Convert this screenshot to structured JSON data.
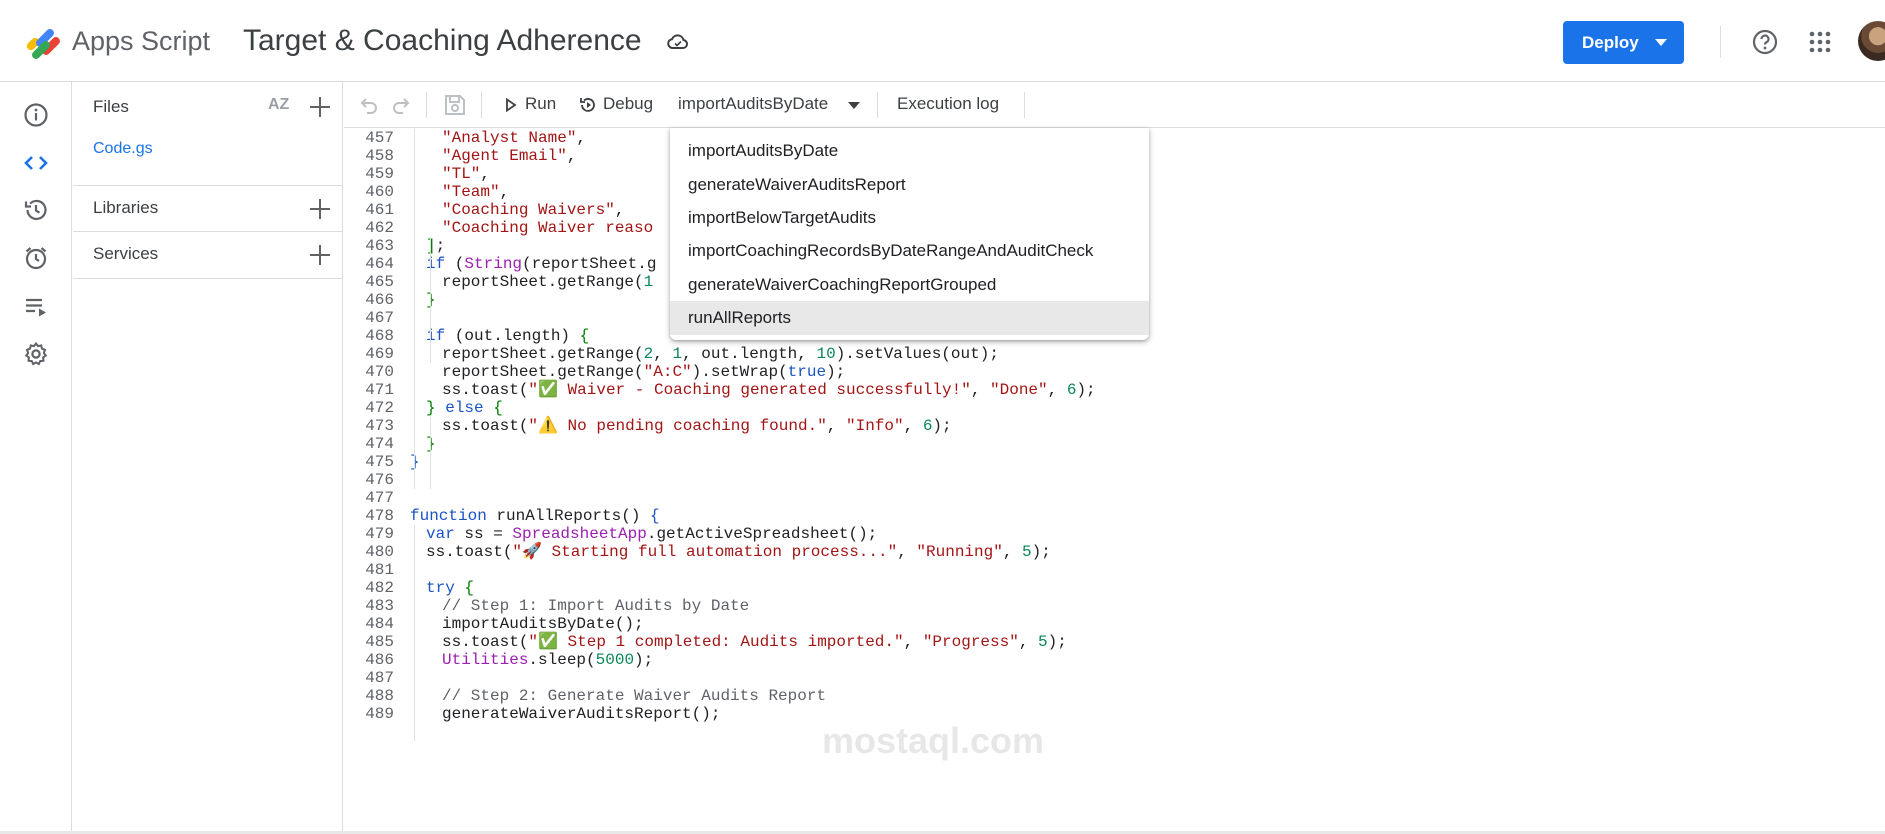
{
  "header": {
    "app_name": "Apps Script",
    "project_title": "Target & Coaching Adherence",
    "deploy_label": "Deploy",
    "icons": [
      "apps-script-logo",
      "cloud-sync-icon",
      "help-icon",
      "apps-grid-icon",
      "account-avatar"
    ]
  },
  "leftnav": {
    "icons": [
      "info-icon",
      "code-icon",
      "history-icon",
      "triggers-icon",
      "executions-icon",
      "settings-icon"
    ]
  },
  "files_panel": {
    "files_label": "Files",
    "sort_label": "AZ",
    "file_name": "Code.gs",
    "libraries_label": "Libraries",
    "services_label": "Services"
  },
  "toolbar": {
    "run_label": "Run",
    "debug_label": "Debug",
    "function_select": "importAuditsByDate",
    "execution_log_label": "Execution log"
  },
  "dropdown": {
    "options": [
      "importAuditsByDate",
      "generateWaiverAuditsReport",
      "importBelowTargetAudits",
      "importCoachingRecordsByDateRangeAndAuditCheck",
      "generateWaiverCoachingReportGrouped",
      "runAllReports"
    ],
    "selected_index": 5
  },
  "editor": {
    "lines": [
      {
        "n": "457",
        "ind": 2,
        "t": [
          [
            "s",
            "\"Analyst Name\""
          ],
          [
            "t",
            ","
          ]
        ]
      },
      {
        "n": "458",
        "ind": 2,
        "t": [
          [
            "s",
            "\"Agent Email\""
          ],
          [
            "t",
            ","
          ]
        ]
      },
      {
        "n": "459",
        "ind": 2,
        "t": [
          [
            "s",
            "\"TL\""
          ],
          [
            "t",
            ","
          ]
        ]
      },
      {
        "n": "460",
        "ind": 2,
        "t": [
          [
            "s",
            "\"Team\""
          ],
          [
            "t",
            ","
          ]
        ]
      },
      {
        "n": "461",
        "ind": 2,
        "t": [
          [
            "s",
            "\"Coaching Waivers\""
          ],
          [
            "t",
            ","
          ]
        ]
      },
      {
        "n": "462",
        "ind": 2,
        "t": [
          [
            "s",
            "\"Coaching Waiver reaso"
          ]
        ]
      },
      {
        "n": "463",
        "ind": 1,
        "t": [
          [
            "p",
            "]"
          ],
          [
            "t",
            ";"
          ]
        ]
      },
      {
        "n": "464",
        "ind": 1,
        "t": [
          [
            "k",
            "if"
          ],
          [
            "t",
            " ("
          ],
          [
            "cl",
            "String"
          ],
          [
            "t",
            "(reportSheet.g"
          ]
        ]
      },
      {
        "n": "465",
        "ind": 2,
        "t": [
          [
            "t",
            "reportSheet.getRange("
          ],
          [
            "n",
            "1"
          ]
        ]
      },
      {
        "n": "466",
        "ind": 1,
        "t": [
          [
            "p",
            "}"
          ]
        ]
      },
      {
        "n": "467",
        "ind": 0,
        "t": []
      },
      {
        "n": "468",
        "ind": 1,
        "t": [
          [
            "k",
            "if"
          ],
          [
            "t",
            " (out.length) "
          ],
          [
            "p",
            "{"
          ]
        ]
      },
      {
        "n": "469",
        "ind": 2,
        "t": [
          [
            "t",
            "reportSheet.getRange("
          ],
          [
            "n",
            "2"
          ],
          [
            "t",
            ", "
          ],
          [
            "n",
            "1"
          ],
          [
            "t",
            ", out.length, "
          ],
          [
            "n",
            "10"
          ],
          [
            "t",
            ").setValues(out);"
          ]
        ]
      },
      {
        "n": "470",
        "ind": 2,
        "t": [
          [
            "t",
            "reportSheet.getRange("
          ],
          [
            "s",
            "\"A:C\""
          ],
          [
            "t",
            ").setWrap("
          ],
          [
            "k",
            "true"
          ],
          [
            "t",
            ");"
          ]
        ]
      },
      {
        "n": "471",
        "ind": 2,
        "t": [
          [
            "t",
            "ss.toast("
          ],
          [
            "s",
            "\"✅ Waiver - Coaching generated successfully!\""
          ],
          [
            "t",
            ", "
          ],
          [
            "s",
            "\"Done\""
          ],
          [
            "t",
            ", "
          ],
          [
            "n",
            "6"
          ],
          [
            "t",
            ");"
          ]
        ]
      },
      {
        "n": "472",
        "ind": 1,
        "t": [
          [
            "p",
            "}"
          ],
          [
            "t",
            " "
          ],
          [
            "k",
            "else"
          ],
          [
            "t",
            " "
          ],
          [
            "p",
            "{"
          ]
        ]
      },
      {
        "n": "473",
        "ind": 2,
        "t": [
          [
            "t",
            "ss.toast("
          ],
          [
            "s",
            "\"⚠️ No pending coaching found.\""
          ],
          [
            "t",
            ", "
          ],
          [
            "s",
            "\"Info\""
          ],
          [
            "t",
            ", "
          ],
          [
            "n",
            "6"
          ],
          [
            "t",
            ");"
          ]
        ]
      },
      {
        "n": "474",
        "ind": 1,
        "t": [
          [
            "p",
            "}"
          ]
        ]
      },
      {
        "n": "475",
        "ind": 0,
        "t": [
          [
            "k",
            "}"
          ]
        ]
      },
      {
        "n": "476",
        "ind": 0,
        "t": []
      },
      {
        "n": "477",
        "ind": 0,
        "t": []
      },
      {
        "n": "478",
        "ind": 0,
        "t": [
          [
            "k",
            "function"
          ],
          [
            "t",
            " runAllReports() "
          ],
          [
            "k",
            "{"
          ]
        ]
      },
      {
        "n": "479",
        "ind": 1,
        "t": [
          [
            "k",
            "var"
          ],
          [
            "t",
            " ss = "
          ],
          [
            "cl",
            "SpreadsheetApp"
          ],
          [
            "t",
            ".getActiveSpreadsheet();"
          ]
        ]
      },
      {
        "n": "480",
        "ind": 1,
        "t": [
          [
            "t",
            "ss.toast("
          ],
          [
            "s",
            "\"🚀 Starting full automation process...\""
          ],
          [
            "t",
            ", "
          ],
          [
            "s",
            "\"Running\""
          ],
          [
            "t",
            ", "
          ],
          [
            "n",
            "5"
          ],
          [
            "t",
            ");"
          ]
        ]
      },
      {
        "n": "481",
        "ind": 0,
        "t": []
      },
      {
        "n": "482",
        "ind": 1,
        "t": [
          [
            "k",
            "try"
          ],
          [
            "t",
            " "
          ],
          [
            "p",
            "{"
          ]
        ]
      },
      {
        "n": "483",
        "ind": 2,
        "t": [
          [
            "c",
            "// Step 1: Import Audits by Date"
          ]
        ]
      },
      {
        "n": "484",
        "ind": 2,
        "t": [
          [
            "t",
            "importAuditsByDate();"
          ]
        ]
      },
      {
        "n": "485",
        "ind": 2,
        "t": [
          [
            "t",
            "ss.toast("
          ],
          [
            "s",
            "\"✅ Step 1 completed: Audits imported.\""
          ],
          [
            "t",
            ", "
          ],
          [
            "s",
            "\"Progress\""
          ],
          [
            "t",
            ", "
          ],
          [
            "n",
            "5"
          ],
          [
            "t",
            ");"
          ]
        ]
      },
      {
        "n": "486",
        "ind": 2,
        "t": [
          [
            "cl",
            "Utilities"
          ],
          [
            "t",
            ".sleep("
          ],
          [
            "n",
            "5000"
          ],
          [
            "t",
            ");"
          ]
        ]
      },
      {
        "n": "487",
        "ind": 0,
        "t": []
      },
      {
        "n": "488",
        "ind": 2,
        "t": [
          [
            "c",
            "// Step 2: Generate Waiver Audits Report"
          ]
        ]
      },
      {
        "n": "489",
        "ind": 2,
        "t": [
          [
            "t",
            "generateWaiverAuditsReport();"
          ]
        ]
      }
    ]
  },
  "watermark": "mostaql.com"
}
